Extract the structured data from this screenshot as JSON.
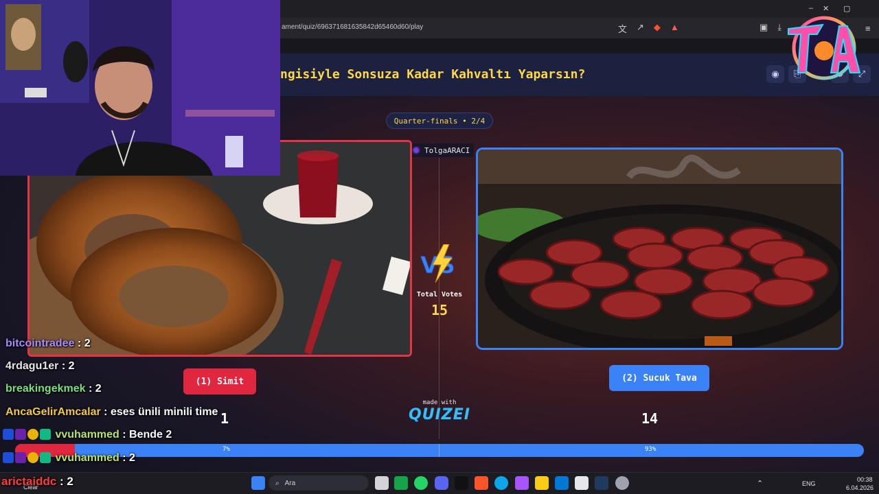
{
  "browser": {
    "url": "ament/quiz/696371681635842d65460d60/play",
    "window_controls": [
      "–",
      "▢",
      "✕"
    ]
  },
  "quiz": {
    "title": "ngisiyle Sonsuza Kadar Kahvaltı Yaparsın?",
    "round": "Quarter-finals • 2/4",
    "creator": "TolgaARACI",
    "vs_label": "VS",
    "total_votes_label": "Total Votes",
    "total_votes": "15",
    "made_with": "made with",
    "brand": "QUIZEI",
    "left": {
      "label": "(1) Simit",
      "votes": "1",
      "percent_label": "7%",
      "percent": 7
    },
    "right": {
      "label": "(2) Sucuk Tava",
      "votes": "14",
      "percent_label": "93%",
      "percent": 93
    },
    "header_icons": [
      "eye-icon",
      "share-icon",
      "settings-icon",
      "fullscreen-icon"
    ]
  },
  "chat": [
    {
      "user": "bitcointradee",
      "color": "#a78bfa",
      "message": " : 2",
      "badges": false
    },
    {
      "user": "4rdagu1er",
      "color": "#e5e5e5",
      "message": " : 2",
      "badges": false
    },
    {
      "user": "breakingekmek",
      "color": "#7be07b",
      "message": " : 2",
      "badges": false
    },
    {
      "user": "AncaGelirAmcalar",
      "color": "#f2c94c",
      "message": " : eses ünili minili time",
      "badges": false
    },
    {
      "user": "vvuhammed",
      "color": "#b7e36b",
      "message": " : Bende 2",
      "badges": true
    },
    {
      "user": "vvuhammed",
      "color": "#b7e36b",
      "message": " : 2",
      "badges": true
    },
    {
      "user": "arictaiddc",
      "color": "#ff3b3b",
      "message": " : 2",
      "badges": false
    }
  ],
  "taskbar": {
    "search_placeholder": "Ara",
    "weather": "Clear",
    "language": "ENG",
    "time": "00:38",
    "date": "6.04.2026"
  },
  "colors": {
    "accent_red": "#e1263f",
    "accent_blue": "#3b82f6",
    "title_yellow": "#ffd84a",
    "brand_cyan": "#38bdf8"
  }
}
